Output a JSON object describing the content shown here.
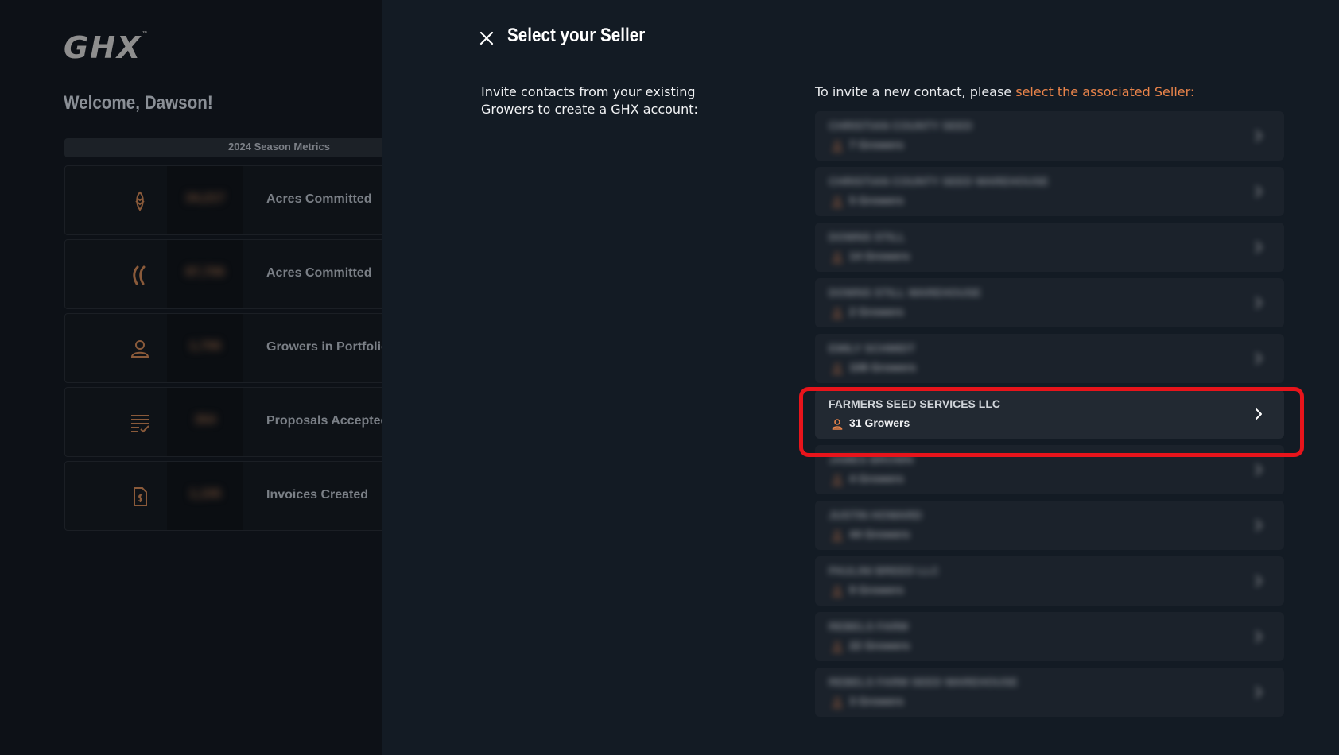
{
  "app": {
    "logo_text": "GHX",
    "logo_mark": "™",
    "welcome": "Welcome, Dawson!",
    "season_label": "2024 Season Metrics",
    "metrics": [
      {
        "icon": "corn-icon",
        "value": "34,217",
        "label": "Acres Committed"
      },
      {
        "icon": "soybean-icon",
        "value": "87,706",
        "label": "Acres Committed"
      },
      {
        "icon": "person-icon",
        "value": "1,706",
        "label": "Growers in Portfolio"
      },
      {
        "icon": "document-check-icon",
        "value": "354",
        "label": "Proposals Accepted"
      },
      {
        "icon": "invoice-dollar-icon",
        "value": "1,106",
        "label": "Invoices Created"
      }
    ]
  },
  "modal": {
    "title": "Select your Seller",
    "intro": "Invite contacts from your existing Growers to create a GHX account:",
    "invite_prefix": "To invite a new contact, please ",
    "invite_accent": "select the associated Seller:",
    "accent_color": "#e8834a",
    "sellers": [
      {
        "name": "CHRISTIAN COUNTY SEED",
        "count": "7 Growers",
        "blurred": true
      },
      {
        "name": "CHRISTIAN COUNTY SEED WAREHOUSE",
        "count": "5 Growers",
        "blurred": true
      },
      {
        "name": "DOWNS STILL",
        "count": "14 Growers",
        "blurred": true
      },
      {
        "name": "DOWNS STILL WAREHOUSE",
        "count": "2 Growers",
        "blurred": true
      },
      {
        "name": "EMILY SCHMIDT",
        "count": "108 Growers",
        "blurred": true
      },
      {
        "name": "FARMERS SEED SERVICES LLC",
        "count": "31 Growers",
        "blurred": false
      },
      {
        "name": "JAMES BROWN",
        "count": "4 Growers",
        "blurred": true
      },
      {
        "name": "JUSTIN HOWARD",
        "count": "44 Growers",
        "blurred": true
      },
      {
        "name": "PAULINI BREED LLC",
        "count": "9 Growers",
        "blurred": true
      },
      {
        "name": "REBELS FARM",
        "count": "22 Growers",
        "blurred": true
      },
      {
        "name": "REBELS FARM SEED WAREHOUSE",
        "count": "3 Growers",
        "blurred": true
      }
    ]
  },
  "annotation": {
    "highlight_color": "#e8141b"
  }
}
